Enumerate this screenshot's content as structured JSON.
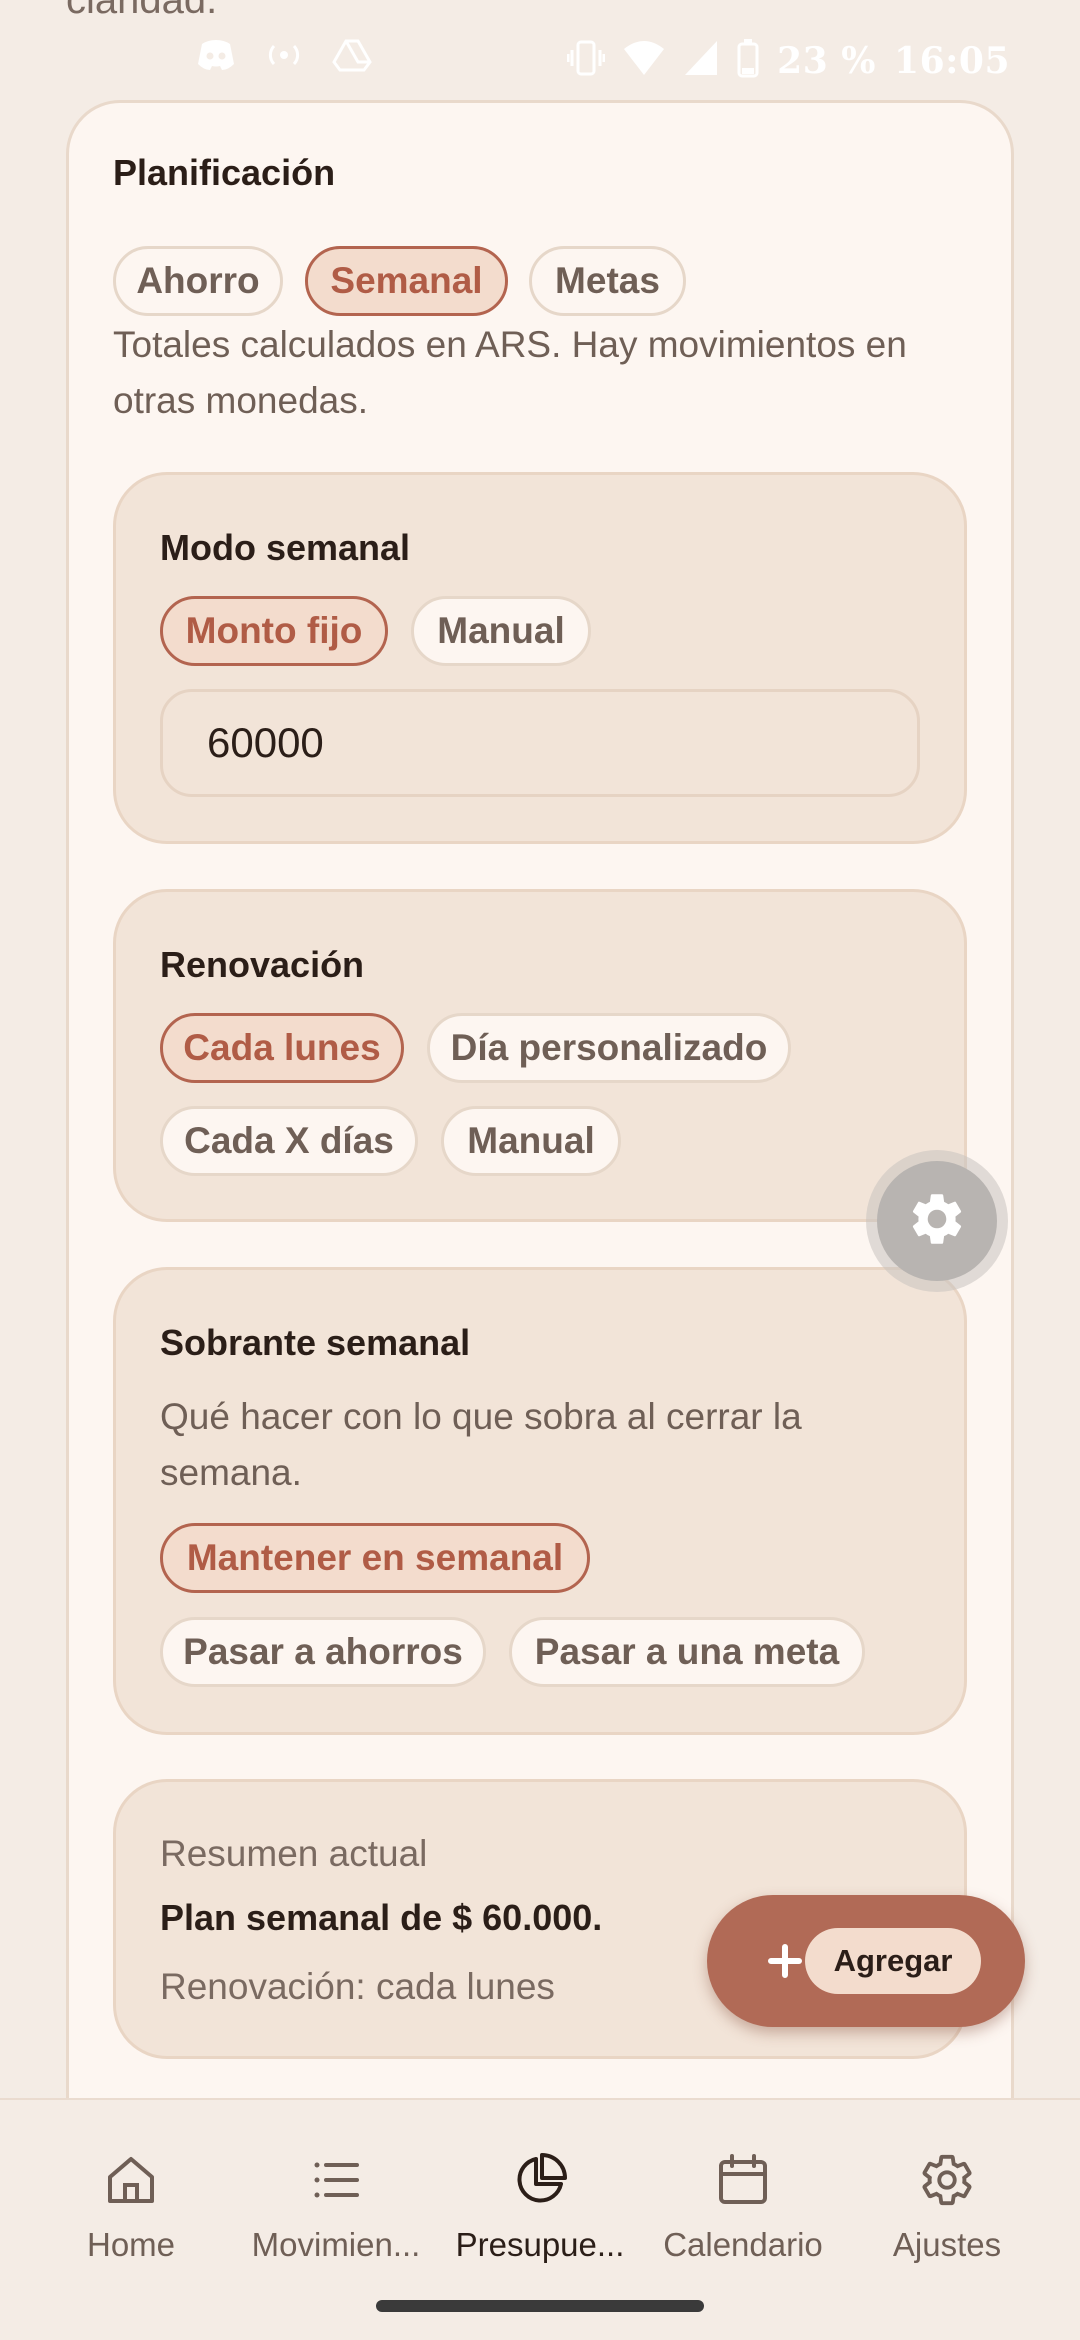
{
  "cutoff_text": "claridad.",
  "status_bar": {
    "battery": "23 %",
    "time": "16:05"
  },
  "planning": {
    "title": "Planificación",
    "tabs": [
      {
        "label": "Ahorro",
        "selected": false
      },
      {
        "label": "Semanal",
        "selected": true
      },
      {
        "label": "Metas",
        "selected": false
      }
    ],
    "note": "Totales calculados en ARS. Hay movimientos en otras monedas."
  },
  "weekly_mode": {
    "title": "Modo semanal",
    "options": [
      {
        "label": "Monto fijo",
        "selected": true
      },
      {
        "label": "Manual",
        "selected": false
      }
    ],
    "amount_value": "60000"
  },
  "renewal": {
    "title": "Renovación",
    "options": [
      {
        "label": "Cada lunes",
        "selected": true
      },
      {
        "label": "Día personalizado",
        "selected": false
      },
      {
        "label": "Cada X días",
        "selected": false
      },
      {
        "label": "Manual",
        "selected": false
      }
    ]
  },
  "leftover": {
    "title": "Sobrante semanal",
    "description": "Qué hacer con lo que sobra al cerrar la semana.",
    "options": [
      {
        "label": "Mantener en semanal",
        "selected": true
      },
      {
        "label": "Pasar a ahorros",
        "selected": false
      },
      {
        "label": "Pasar a una meta",
        "selected": false
      }
    ]
  },
  "summary": {
    "label": "Resumen actual",
    "plan": "Plan semanal de $ 60.000.",
    "renewal": "Renovación: cada lunes"
  },
  "fab": {
    "label": "Agregar",
    "icon": "plus-icon"
  },
  "settings_fab": {
    "icon": "gear-icon"
  },
  "bottom_nav": [
    {
      "label": "Home",
      "icon": "home-icon",
      "active": false
    },
    {
      "label": "Movimien...",
      "icon": "list-icon",
      "active": false
    },
    {
      "label": "Presupue...",
      "icon": "pie-chart-icon",
      "active": true
    },
    {
      "label": "Calendario",
      "icon": "calendar-icon",
      "active": false
    },
    {
      "label": "Ajustes",
      "icon": "settings-icon",
      "active": false
    }
  ],
  "colors": {
    "accent": "#b16a56",
    "selected_chip_bg": "#f3dccd",
    "card_bg": "#fdf6f1",
    "section_bg": "#f2e4d8",
    "page_bg": "#f4ece5"
  }
}
